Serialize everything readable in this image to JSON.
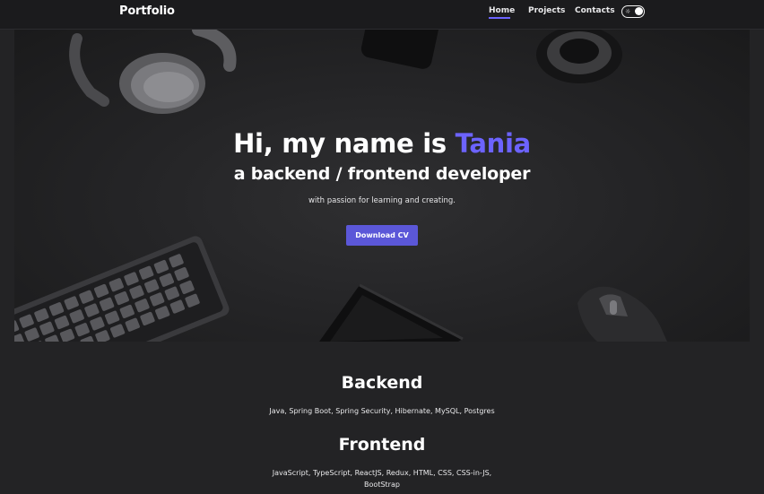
{
  "header": {
    "logo": "Portfolio",
    "nav": [
      {
        "label": "Home"
      },
      {
        "label": "Projects"
      },
      {
        "label": "Contacts"
      }
    ],
    "theme_toggle_icon": "sun-icon"
  },
  "hero": {
    "title_prefix": "Hi, my name is ",
    "title_name": "Tania",
    "subtitle": "a backend / frontend developer",
    "tagline": "with passion for learning and creating.",
    "cta_label": "Download CV",
    "accent_color": "#6c63ff"
  },
  "skills": [
    {
      "title": "Backend",
      "text": "Java, Spring Boot, Spring Security, Hibernate, MySQL, Postgres"
    },
    {
      "title": "Frontend",
      "text": "JavaScript, TypeScript, ReactJS, Redux, HTML, CSS, CSS-in-JS, BootStrap"
    }
  ]
}
